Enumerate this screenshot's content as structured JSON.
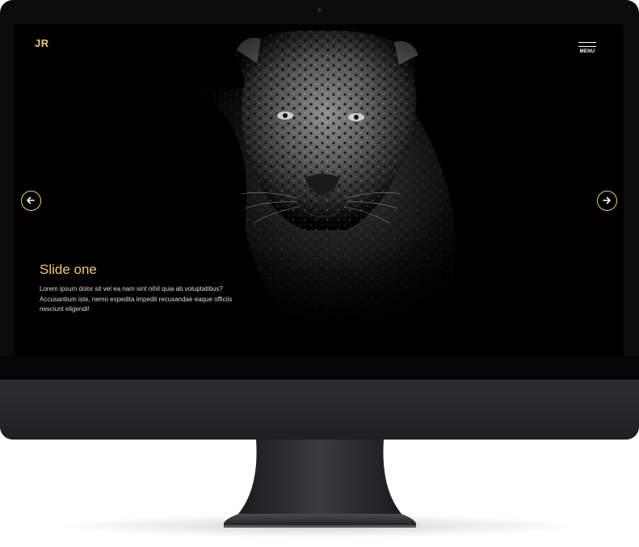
{
  "brand": {
    "logo_text": "JR",
    "accent_color": "#f2c87a"
  },
  "nav": {
    "menu_label": "MENU"
  },
  "slide": {
    "title": "Slide one",
    "text_lines": [
      "Lorem ipsum dolor sit vel ea nam sint nihil quia ab voluptatibus?",
      "Accusantium iste, nemo expedita impedit recusandae eaque officiis",
      "nesciunt eligendi!"
    ]
  },
  "controls": {
    "prev_icon": "arrow-left-icon",
    "next_icon": "arrow-right-icon"
  },
  "device": {
    "type": "desktop monitor mockup"
  }
}
